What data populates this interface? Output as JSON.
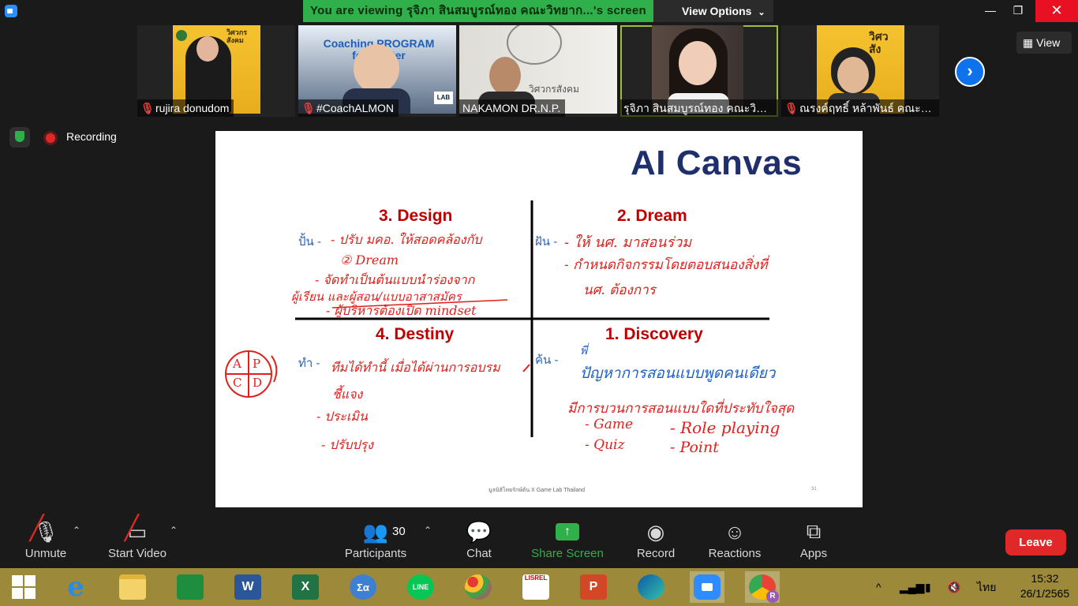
{
  "window": {
    "banner": "You are viewing รุจิภา สินสมบูรณ์ทอง คณะวิทยาก...'s screen",
    "view_options": "View Options",
    "minimize": "—",
    "maximize": "❐",
    "close": "✕"
  },
  "participants_strip": [
    {
      "name": "rujira donudom",
      "muted": true
    },
    {
      "name": "#CoachALMON",
      "muted": true
    },
    {
      "name": "NAKAMON DR.N.P.",
      "muted": false
    },
    {
      "name": "รุจิภา สินสมบูรณ์ทอง คณะวิทย...",
      "muted": false,
      "active": true
    },
    {
      "name": "ณรงค์ฤทธิ์ หล้าพันธ์ คณะว...",
      "muted": true
    }
  ],
  "video_texts": {
    "t1_logo": "วิศวกร สังคม",
    "t2_banner": "Coaching PROGRAM for Master",
    "t2_lab": "LAB",
    "t3_text": "วิศวกรสังคม",
    "t5_logo": "วิศว สัง"
  },
  "view_button": "View",
  "recording_label": "Recording",
  "slide": {
    "title": "AI Canvas",
    "quadrants": {
      "design": "3. Design",
      "dream": "2. Dream",
      "destiny": "4. Destiny",
      "discovery": "1. Discovery"
    },
    "labels": {
      "design": "ปั้น -",
      "dream": "ฝัน -",
      "destiny": "ทำ -",
      "discovery": "ค้น -"
    },
    "handwriting": {
      "design": [
        "- ปรับ มคอ. ให้สอดคล้องกับ",
        "② Dream",
        "- จัดทำเป็นต้นแบบนำร่องจาก",
        "ผู้เรียน และผู้สอน/แบบอาสาสมัคร",
        "- ผู้บริหารต้องเปิด mindset"
      ],
      "dream": [
        "- ให้ นศ. มาสอนร่วม",
        "- กำหนดกิจกรรมโดยตอบสนองสิ่งที่",
        "นศ. ต้องการ"
      ],
      "destiny": [
        "ทีมได้ทำนี้ เมื่อได้ผ่านการอบรม",
        "ชี้แจง",
        "- ประเมิน",
        "- ปรับปรุง"
      ],
      "apcd": [
        "A",
        "P",
        "C",
        "D"
      ],
      "discovery": [
        "พี่",
        "ปัญหาการสอนแบบพูดคนเดียว",
        "มีการบวนการสอนแบบใดที่ประทับใจสุด",
        "- Game",
        "- Role playing",
        "- Quiz",
        "- Point"
      ]
    },
    "footer": "มูลนิธิไทยรักษ์ต้น X Game Lab Thailand",
    "page": "31"
  },
  "toolbar": {
    "unmute": "Unmute",
    "start_video": "Start Video",
    "participants": "Participants",
    "participants_count": "30",
    "chat": "Chat",
    "share_screen": "Share Screen",
    "record": "Record",
    "reactions": "Reactions",
    "apps": "Apps",
    "leave": "Leave"
  },
  "taskbar": {
    "apps": [
      {
        "name": "start",
        "label": ""
      },
      {
        "name": "internet-explorer",
        "label": "e"
      },
      {
        "name": "file-explorer",
        "label": ""
      },
      {
        "name": "store",
        "label": ""
      },
      {
        "name": "word",
        "label": "W"
      },
      {
        "name": "excel",
        "label": "X"
      },
      {
        "name": "math",
        "label": "Σα"
      },
      {
        "name": "line",
        "label": "LINE"
      },
      {
        "name": "paint",
        "label": ""
      },
      {
        "name": "lisrel",
        "label": "LISREL"
      },
      {
        "name": "powerpoint",
        "label": "P"
      },
      {
        "name": "edge",
        "label": ""
      },
      {
        "name": "zoom",
        "label": ""
      },
      {
        "name": "chrome",
        "label": "R"
      }
    ],
    "language": "ไทย",
    "time": "15:32",
    "date": "26/1/2565"
  },
  "colors": {
    "banner_green": "#2fb04a",
    "leave_red": "#e02828",
    "slide_title": "#1f2f6b",
    "quadrant_title": "#c00000",
    "taskbar": "#9c8a3a"
  }
}
